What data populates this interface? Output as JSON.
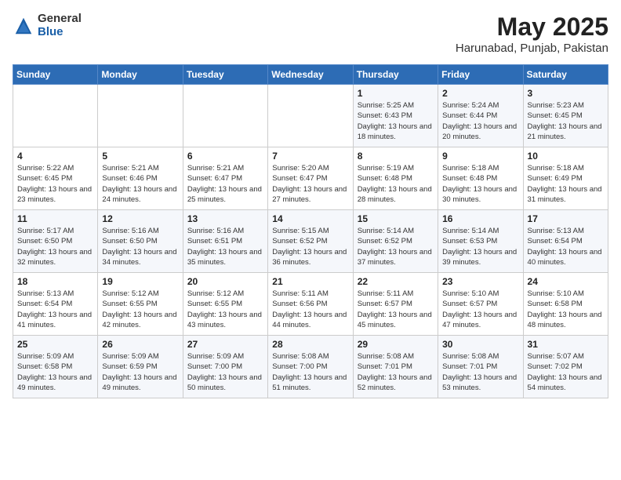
{
  "header": {
    "logo_general": "General",
    "logo_blue": "Blue",
    "month_year": "May 2025",
    "location": "Harunabad, Punjab, Pakistan"
  },
  "days_of_week": [
    "Sunday",
    "Monday",
    "Tuesday",
    "Wednesday",
    "Thursday",
    "Friday",
    "Saturday"
  ],
  "weeks": [
    [
      {
        "day": "",
        "info": ""
      },
      {
        "day": "",
        "info": ""
      },
      {
        "day": "",
        "info": ""
      },
      {
        "day": "",
        "info": ""
      },
      {
        "day": "1",
        "info": "Sunrise: 5:25 AM\nSunset: 6:43 PM\nDaylight: 13 hours\nand 18 minutes."
      },
      {
        "day": "2",
        "info": "Sunrise: 5:24 AM\nSunset: 6:44 PM\nDaylight: 13 hours\nand 20 minutes."
      },
      {
        "day": "3",
        "info": "Sunrise: 5:23 AM\nSunset: 6:45 PM\nDaylight: 13 hours\nand 21 minutes."
      }
    ],
    [
      {
        "day": "4",
        "info": "Sunrise: 5:22 AM\nSunset: 6:45 PM\nDaylight: 13 hours\nand 23 minutes."
      },
      {
        "day": "5",
        "info": "Sunrise: 5:21 AM\nSunset: 6:46 PM\nDaylight: 13 hours\nand 24 minutes."
      },
      {
        "day": "6",
        "info": "Sunrise: 5:21 AM\nSunset: 6:47 PM\nDaylight: 13 hours\nand 25 minutes."
      },
      {
        "day": "7",
        "info": "Sunrise: 5:20 AM\nSunset: 6:47 PM\nDaylight: 13 hours\nand 27 minutes."
      },
      {
        "day": "8",
        "info": "Sunrise: 5:19 AM\nSunset: 6:48 PM\nDaylight: 13 hours\nand 28 minutes."
      },
      {
        "day": "9",
        "info": "Sunrise: 5:18 AM\nSunset: 6:48 PM\nDaylight: 13 hours\nand 30 minutes."
      },
      {
        "day": "10",
        "info": "Sunrise: 5:18 AM\nSunset: 6:49 PM\nDaylight: 13 hours\nand 31 minutes."
      }
    ],
    [
      {
        "day": "11",
        "info": "Sunrise: 5:17 AM\nSunset: 6:50 PM\nDaylight: 13 hours\nand 32 minutes."
      },
      {
        "day": "12",
        "info": "Sunrise: 5:16 AM\nSunset: 6:50 PM\nDaylight: 13 hours\nand 34 minutes."
      },
      {
        "day": "13",
        "info": "Sunrise: 5:16 AM\nSunset: 6:51 PM\nDaylight: 13 hours\nand 35 minutes."
      },
      {
        "day": "14",
        "info": "Sunrise: 5:15 AM\nSunset: 6:52 PM\nDaylight: 13 hours\nand 36 minutes."
      },
      {
        "day": "15",
        "info": "Sunrise: 5:14 AM\nSunset: 6:52 PM\nDaylight: 13 hours\nand 37 minutes."
      },
      {
        "day": "16",
        "info": "Sunrise: 5:14 AM\nSunset: 6:53 PM\nDaylight: 13 hours\nand 39 minutes."
      },
      {
        "day": "17",
        "info": "Sunrise: 5:13 AM\nSunset: 6:54 PM\nDaylight: 13 hours\nand 40 minutes."
      }
    ],
    [
      {
        "day": "18",
        "info": "Sunrise: 5:13 AM\nSunset: 6:54 PM\nDaylight: 13 hours\nand 41 minutes."
      },
      {
        "day": "19",
        "info": "Sunrise: 5:12 AM\nSunset: 6:55 PM\nDaylight: 13 hours\nand 42 minutes."
      },
      {
        "day": "20",
        "info": "Sunrise: 5:12 AM\nSunset: 6:55 PM\nDaylight: 13 hours\nand 43 minutes."
      },
      {
        "day": "21",
        "info": "Sunrise: 5:11 AM\nSunset: 6:56 PM\nDaylight: 13 hours\nand 44 minutes."
      },
      {
        "day": "22",
        "info": "Sunrise: 5:11 AM\nSunset: 6:57 PM\nDaylight: 13 hours\nand 45 minutes."
      },
      {
        "day": "23",
        "info": "Sunrise: 5:10 AM\nSunset: 6:57 PM\nDaylight: 13 hours\nand 47 minutes."
      },
      {
        "day": "24",
        "info": "Sunrise: 5:10 AM\nSunset: 6:58 PM\nDaylight: 13 hours\nand 48 minutes."
      }
    ],
    [
      {
        "day": "25",
        "info": "Sunrise: 5:09 AM\nSunset: 6:58 PM\nDaylight: 13 hours\nand 49 minutes."
      },
      {
        "day": "26",
        "info": "Sunrise: 5:09 AM\nSunset: 6:59 PM\nDaylight: 13 hours\nand 49 minutes."
      },
      {
        "day": "27",
        "info": "Sunrise: 5:09 AM\nSunset: 7:00 PM\nDaylight: 13 hours\nand 50 minutes."
      },
      {
        "day": "28",
        "info": "Sunrise: 5:08 AM\nSunset: 7:00 PM\nDaylight: 13 hours\nand 51 minutes."
      },
      {
        "day": "29",
        "info": "Sunrise: 5:08 AM\nSunset: 7:01 PM\nDaylight: 13 hours\nand 52 minutes."
      },
      {
        "day": "30",
        "info": "Sunrise: 5:08 AM\nSunset: 7:01 PM\nDaylight: 13 hours\nand 53 minutes."
      },
      {
        "day": "31",
        "info": "Sunrise: 5:07 AM\nSunset: 7:02 PM\nDaylight: 13 hours\nand 54 minutes."
      }
    ]
  ]
}
